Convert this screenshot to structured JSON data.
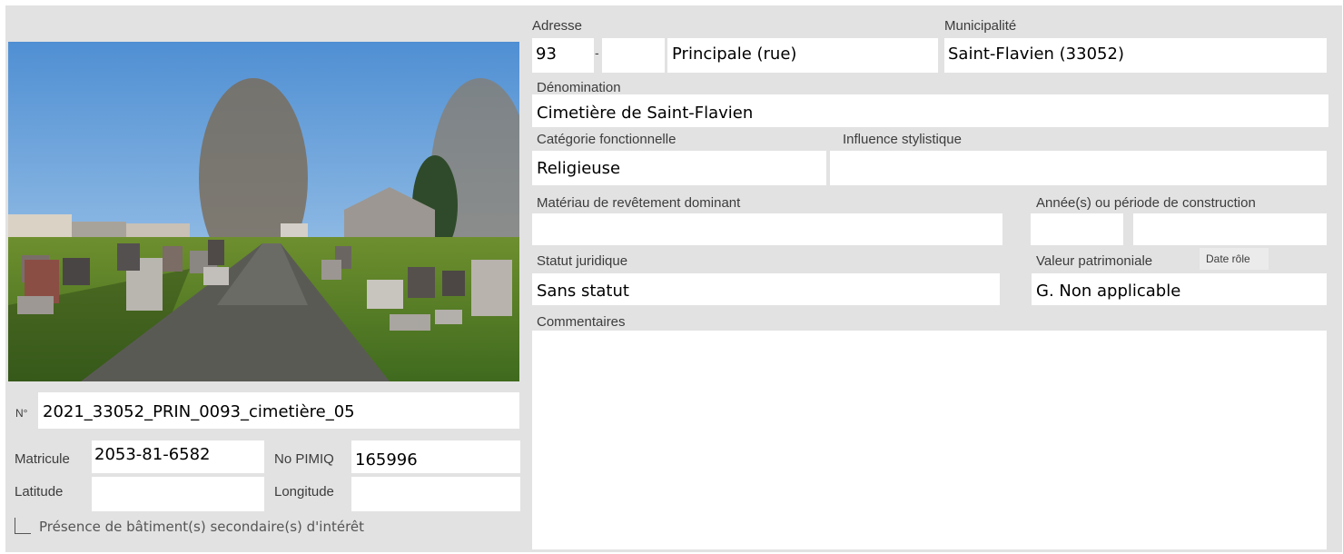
{
  "address": {
    "label": "Adresse",
    "number": "93",
    "separator": "-",
    "number_end": "",
    "street": "Principale (rue)"
  },
  "municipality": {
    "label": "Municipalité",
    "value": "Saint-Flavien (33052)"
  },
  "denomination": {
    "label": "Dénomination",
    "value": "Cimetière de Saint-Flavien"
  },
  "functional_category": {
    "label": "Catégorie fonctionnelle",
    "value": "Religieuse"
  },
  "stylistic_influence": {
    "label": "Influence stylistique",
    "value": ""
  },
  "cladding_material": {
    "label": "Matériau de revêtement dominant",
    "value": ""
  },
  "construction_period": {
    "label": "Année(s) ou période de construction",
    "value_start": "",
    "value_end": ""
  },
  "legal_status": {
    "label": "Statut juridique",
    "value": "Sans statut"
  },
  "heritage_value": {
    "label": "Valeur patrimoniale",
    "date_label": "Date rôle",
    "value": "G. Non applicable"
  },
  "comments": {
    "label": "Commentaires",
    "value": ""
  },
  "photo": {
    "number_label": "N°",
    "number_value": "2021_33052_PRIN_0093_cimetière_05"
  },
  "matricule": {
    "label": "Matricule",
    "value": "2053-81-6582"
  },
  "pimiq": {
    "label": "No PIMIQ",
    "value": "165996"
  },
  "latitude": {
    "label": "Latitude",
    "value": ""
  },
  "longitude": {
    "label": "Longitude",
    "value": ""
  },
  "secondary_buildings": {
    "label": "Présence de bâtiment(s) secondaire(s) d'intérêt",
    "checked": false
  }
}
